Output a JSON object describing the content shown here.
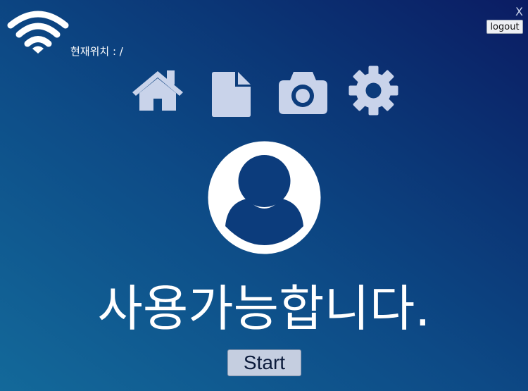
{
  "header": {
    "location_text": "현재위치 : /",
    "close_label": "X",
    "logout_label": "logout"
  },
  "nav": {
    "items": [
      {
        "icon": "home-icon"
      },
      {
        "icon": "file-icon"
      },
      {
        "icon": "camera-icon"
      },
      {
        "icon": "gear-icon"
      }
    ]
  },
  "main": {
    "avatar_icon": "user-avatar-icon",
    "status_text": "사용가능합니다.",
    "start_label": "Start"
  },
  "colors": {
    "icon": "#c9d3ea",
    "accent_dark": "#0c3c7c"
  }
}
